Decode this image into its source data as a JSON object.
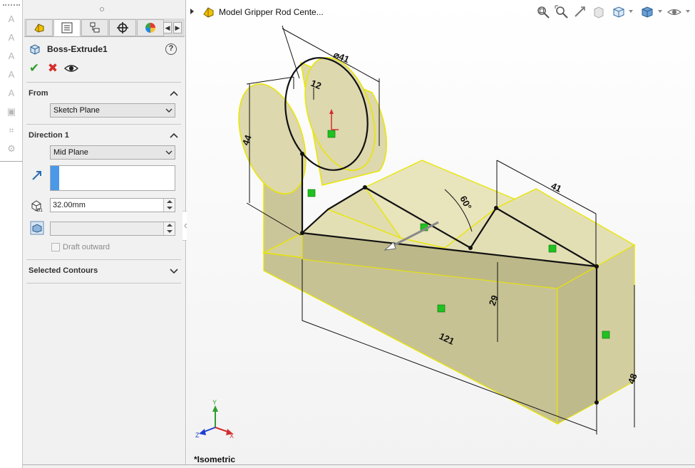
{
  "feature": {
    "title": "Boss-Extrude1",
    "help": "?"
  },
  "pm_tabs": [
    {
      "icon": "feature-manager-icon"
    },
    {
      "icon": "property-manager-icon"
    },
    {
      "icon": "configuration-manager-icon"
    },
    {
      "icon": "dimxpert-manager-icon"
    },
    {
      "icon": "display-manager-icon"
    }
  ],
  "actions": {
    "ok": "✔",
    "cancel": "✖",
    "preview": "eye-icon"
  },
  "from_section": {
    "title": "From",
    "value": "Sketch Plane"
  },
  "direction1": {
    "title": "Direction 1",
    "end_condition": "Mid Plane",
    "depth": "32.00mm",
    "draft_value": "",
    "draft_outward": "Draft outward"
  },
  "selected_contours": {
    "title": "Selected Contours"
  },
  "breadcrumb": {
    "label": "Model Gripper Rod Cente..."
  },
  "view": {
    "name": "*Isometric"
  },
  "triad": {
    "x": "X",
    "y": "Y",
    "z": "Z"
  },
  "dimensions": {
    "diameter": "⌀41",
    "d12": "12",
    "d44": "44",
    "angle": "60°",
    "d41": "41",
    "d29": "29",
    "d121": "121",
    "d48": "48"
  },
  "colors": {
    "model_fill": "#e7e3b6",
    "model_face_dark": "#c2bc8c",
    "model_edge": "#f0f000",
    "sketch": "#111111",
    "relation": "#1fc21f",
    "accent_blue": "#4a98e8"
  }
}
